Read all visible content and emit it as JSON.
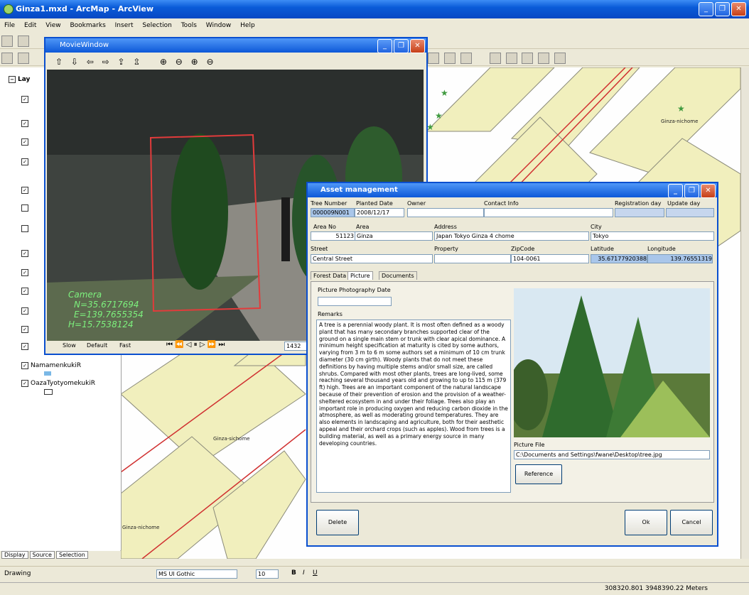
{
  "app": {
    "title": "Ginza1.mxd - ArcMap - ArcView",
    "menu": [
      "File",
      "Edit",
      "View",
      "Bookmarks",
      "Insert",
      "Selection",
      "Tools",
      "Window",
      "Help"
    ]
  },
  "toc": {
    "root_label": "Lay",
    "layers": [
      "NamamenkukiR",
      "OazaTyotyomekukiR"
    ],
    "tabs": [
      "Display",
      "Source",
      "Selection"
    ]
  },
  "map": {
    "labels": [
      "Ginza-nichome",
      "Ginza-sichome",
      "Ginza-nichome"
    ]
  },
  "movie": {
    "title": "MovieWindow",
    "camera_title": "Camera",
    "camera_n": "N=35.6717694",
    "camera_e": "E=139.7655354",
    "camera_h": "H=15.7538124",
    "speed_labels": [
      "Slow",
      "Default",
      "Fast"
    ],
    "frame": "1432"
  },
  "asset": {
    "title": "Asset management",
    "labels": {
      "tree_number": "Tree Number",
      "planted_date": "Planted Date",
      "owner": "Owner",
      "contact": "Contact Info",
      "reg_day": "Registration day",
      "update_day": "Update day",
      "area_no": "Area No",
      "area": "Area",
      "address": "Address",
      "city": "City",
      "street": "Street",
      "property": "Property",
      "zipcode": "ZipCode",
      "latitude": "Latitude",
      "longitude": "Longitude",
      "photo_date": "Picture Photography Date",
      "remarks": "Remarks",
      "picture_file": "Picture File"
    },
    "values": {
      "tree_number": "000009N001",
      "planted_date": "2008/12/17",
      "area_no": "51123",
      "area": "Ginza",
      "address": "Japan Tokyo Ginza 4 chome",
      "city": "Tokyo",
      "street": "Central Street",
      "zipcode": "104-0061",
      "latitude": "35.67177920388",
      "longitude": "139.76551319",
      "picture_file": "C:\\Documents and Settings\\fwane\\Desktop\\tree.jpg"
    },
    "tabs": [
      "Forest Data",
      "Picture",
      "Documents"
    ],
    "remarks": "A tree is a perennial woody plant. It is most often defined as a woody plant that has many secondary branches supported clear of the ground on a single main stem or trunk with clear apical dominance. A minimum height specification at maturity is cited by some authors, varying from 3 m to 6 m some authors set a minimum of 10 cm trunk diameter (30 cm girth). Woody plants that do not meet these definitions by having multiple stems and/or small size, are called shrubs. Compared with most other plants, trees are long-lived, some reaching several thousand years old and growing to up to 115 m (379 ft) high. Trees are an important component of the natural landscape because of their prevention of erosion and the provision of a weather-sheltered ecosystem in and under their foliage. Trees also play an important role in producing oxygen and reducing carbon dioxide in the atmosphere, as well as moderating ground temperatures. They are also elements in landscaping and agriculture, both for their aesthetic appeal and their orchard crops (such as apples). Wood from trees is a building material, as well as a primary energy source in many developing countries.",
    "buttons": {
      "reference": "Reference",
      "delete": "Delete",
      "ok": "Ok",
      "cancel": "Cancel"
    }
  },
  "drawbar": {
    "drawing": "Drawing",
    "font": "MS UI Gothic",
    "size": "10"
  },
  "status": {
    "coords": "308320.801  3948390.22 Meters"
  }
}
